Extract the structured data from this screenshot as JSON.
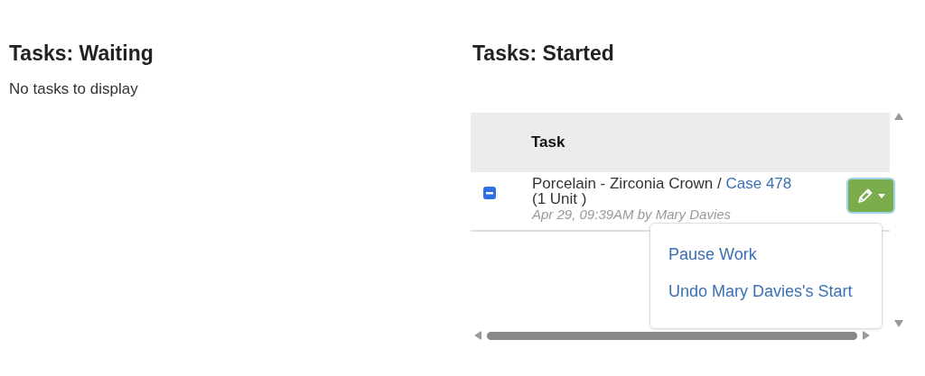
{
  "waiting": {
    "title": "Tasks: Waiting",
    "empty_message": "No tasks to display"
  },
  "started": {
    "title": "Tasks: Started",
    "table": {
      "columns": [
        "Task"
      ],
      "rows": [
        {
          "expanded": true,
          "task": "Porcelain - Zirconia Crown / ",
          "case_link": "Case 478",
          "units": " (1 Unit )",
          "meta": "Apr 29, 09:39AM by Mary Davies"
        }
      ]
    },
    "action_menu": {
      "items": [
        "Pause Work",
        "Undo Mary Davies's Start"
      ]
    }
  }
}
